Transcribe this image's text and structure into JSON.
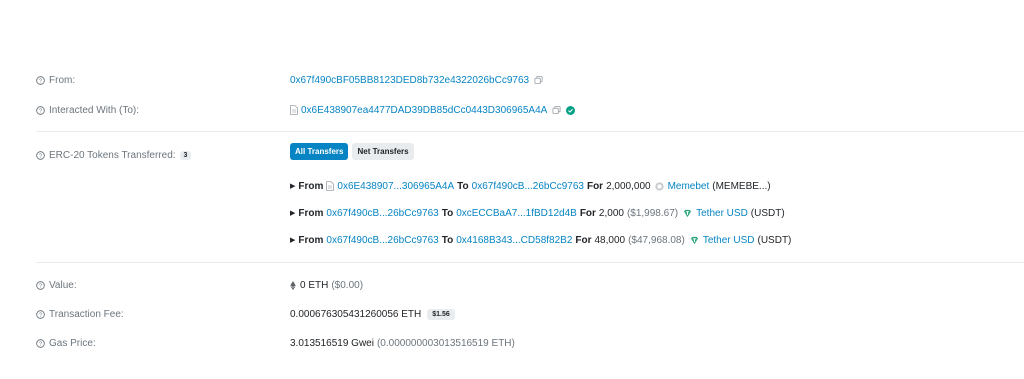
{
  "rows": {
    "from": {
      "label": "From:",
      "address": "0x67f490cBF05BB8123DED8b732e4322026bCc9763"
    },
    "to": {
      "label": "Interacted With (To):",
      "address": "0x6E438907ea4477DAD39DB85dCc0443D306965A4A"
    },
    "erc20": {
      "label": "ERC-20 Tokens Transferred:",
      "count": "3",
      "tabs": [
        "All Transfers",
        "Net Transfers"
      ],
      "transfers": [
        {
          "from_word": "From",
          "from": "0x6E438907...306965A4A",
          "to_word": "To",
          "to": "0x67f490cB...26bCc9763",
          "for_word": "For",
          "amount": "2,000,000",
          "usd": "",
          "token_name": "Memebet",
          "token_symbol": "(MEMEBE...)",
          "icon": "memebet-token-icon",
          "from_is_contract": true
        },
        {
          "from_word": "From",
          "from": "0x67f490cB...26bCc9763",
          "to_word": "To",
          "to": "0xcECCBaA7...1fBD12d4B",
          "for_word": "For",
          "amount": "2,000",
          "usd": "($1,998.67)",
          "token_name": "Tether USD",
          "token_symbol": "(USDT)",
          "icon": "tether-token-icon",
          "from_is_contract": false
        },
        {
          "from_word": "From",
          "from": "0x67f490cB...26bCc9763",
          "to_word": "To",
          "to": "0x4168B343...CD58f82B2",
          "for_word": "For",
          "amount": "48,000",
          "usd": "($47,968.08)",
          "token_name": "Tether USD",
          "token_symbol": "(USDT)",
          "icon": "tether-token-icon",
          "from_is_contract": false
        }
      ]
    },
    "value": {
      "label": "Value:",
      "amount": "0 ETH",
      "usd": "($0.00)"
    },
    "fee": {
      "label": "Transaction Fee:",
      "amount": "0.000676305431260056 ETH",
      "usd": "$1.56"
    },
    "gas": {
      "label": "Gas Price:",
      "amount": "3.013516519 Gwei",
      "eth": "(0.000000003013516519 ETH)"
    }
  },
  "colors": {
    "link": "#0784c3",
    "label": "#6c757d",
    "verified": "#00a186",
    "tether": "#26a17b",
    "primary": "#0784c3"
  },
  "icons": {
    "help": "question-circle-icon",
    "copy": "copy-icon",
    "contract": "contract-document-icon",
    "verified": "check-circle-icon",
    "eth": "ethereum-icon"
  }
}
